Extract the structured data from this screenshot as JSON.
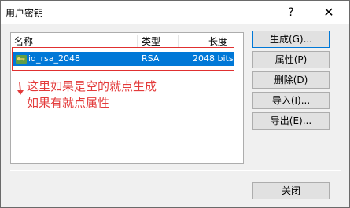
{
  "window": {
    "title": "用户密钥",
    "help_label": "?",
    "close_label": "✕"
  },
  "list": {
    "columns": [
      "名称",
      "类型",
      "长度"
    ],
    "rows": [
      {
        "name": "id_rsa_2048",
        "type": "RSA",
        "length": "2048 bits",
        "selected": true
      }
    ]
  },
  "annotation": {
    "line1": "这里如果是空的就点生成",
    "line2": "如果有就点属性",
    "color": "#e33b3b"
  },
  "buttons": {
    "generate": "生成(G)...",
    "properties": "属性(P)",
    "delete": "删除(D)",
    "import": "导入(I)...",
    "export": "导出(E)...",
    "close": "关闭"
  },
  "colors": {
    "selection": "#0078d7",
    "highlight_box": "#e03030"
  }
}
